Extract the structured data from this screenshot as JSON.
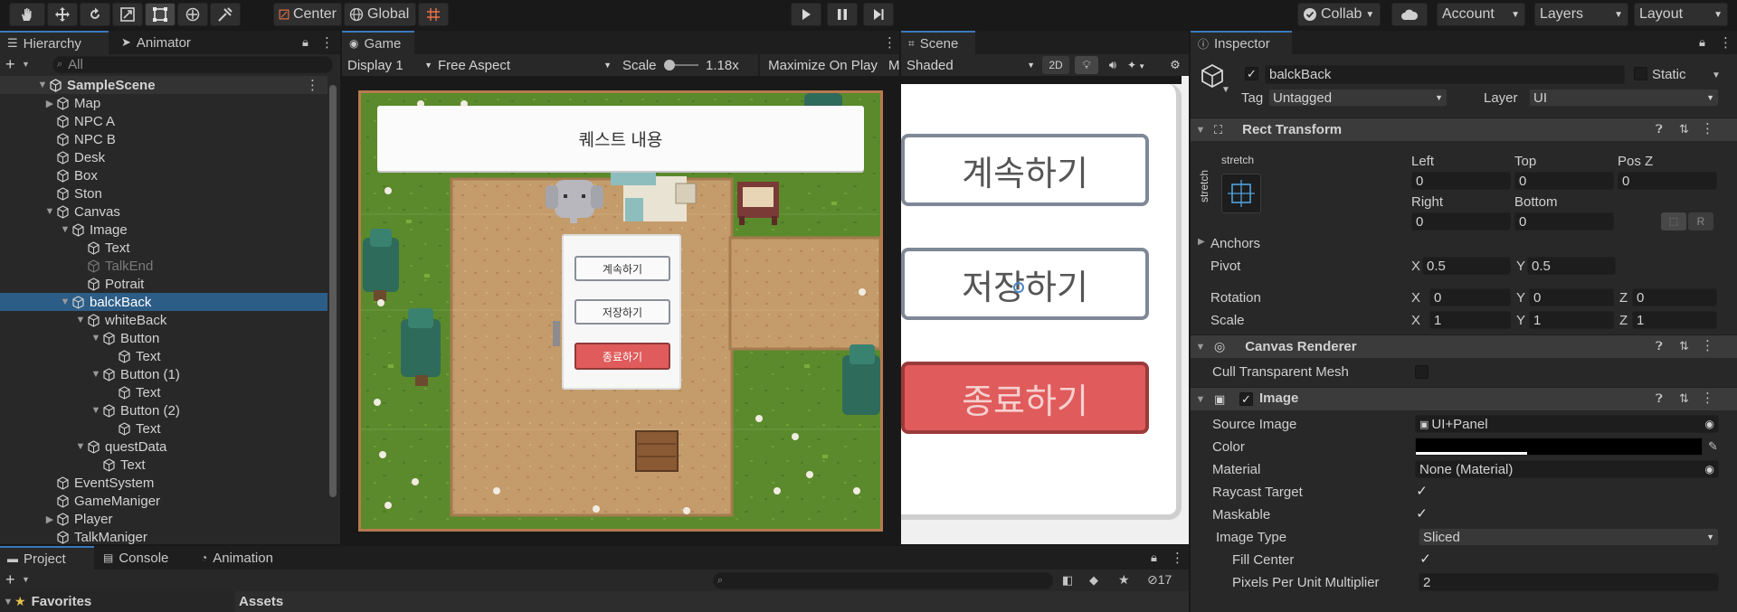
{
  "toolbar": {
    "pivot_label": "Center",
    "space_label": "Global",
    "collab_label": "Collab",
    "account_label": "Account",
    "layers_label": "Layers",
    "layout_label": "Layout"
  },
  "hierarchy": {
    "tab_label": "Hierarchy",
    "animator_tab_label": "Animator",
    "search_placeholder": "All",
    "scene_name": "SampleScene",
    "items": [
      {
        "label": "Map"
      },
      {
        "label": "NPC A"
      },
      {
        "label": "NPC B"
      },
      {
        "label": "Desk"
      },
      {
        "label": "Box"
      },
      {
        "label": "Ston"
      },
      {
        "label": "Canvas"
      },
      {
        "label": "Image"
      },
      {
        "label": "Text"
      },
      {
        "label": "TalkEnd"
      },
      {
        "label": "Potrait"
      },
      {
        "label": "balckBack"
      },
      {
        "label": "whiteBack"
      },
      {
        "label": "Button"
      },
      {
        "label": "Text"
      },
      {
        "label": "Button (1)"
      },
      {
        "label": "Text"
      },
      {
        "label": "Button (2)"
      },
      {
        "label": "Text"
      },
      {
        "label": "questData"
      },
      {
        "label": "Text"
      },
      {
        "label": "EventSystem"
      },
      {
        "label": "GameManiger"
      },
      {
        "label": "Player"
      },
      {
        "label": "TalkManiger"
      }
    ]
  },
  "game": {
    "tab_label": "Game",
    "display": "Display 1",
    "aspect": "Free Aspect",
    "scale_label": "Scale",
    "scale_value": "1.18x",
    "maximize_label": "Maximize On Play",
    "more_label": "M",
    "quest_text": "퀘스트 내용",
    "menu_continue": "계속하기",
    "menu_save": "저장하기",
    "menu_quit": "종료하기"
  },
  "scene": {
    "tab_label": "Scene",
    "shading": "Shaded",
    "mode_2d": "2D",
    "btn_continue": "계속하기",
    "btn_save": "저장하기",
    "btn_quit": "종료하기"
  },
  "inspector": {
    "tab_label": "Inspector",
    "object_name": "balckBack",
    "static_label": "Static",
    "tag_label": "Tag",
    "tag_value": "Untagged",
    "layer_label": "Layer",
    "layer_value": "UI",
    "rect_transform": {
      "title": "Rect Transform",
      "anchor_h": "stretch",
      "anchor_v": "stretch",
      "left_label": "Left",
      "left": "0",
      "top_label": "Top",
      "top": "0",
      "posz_label": "Pos Z",
      "posz": "0",
      "right_label": "Right",
      "right": "0",
      "bottom_label": "Bottom",
      "bottom": "0",
      "r_button": "R",
      "anchors_label": "Anchors",
      "pivot_label": "Pivot",
      "pivot_x": "0.5",
      "pivot_y": "0.5",
      "rotation_label": "Rotation",
      "rot_x": "0",
      "rot_y": "0",
      "rot_z": "0",
      "scale_label": "Scale",
      "scale_x": "1",
      "scale_y": "1",
      "scale_z": "1",
      "x": "X",
      "y": "Y",
      "z": "Z"
    },
    "canvas_renderer": {
      "title": "Canvas Renderer",
      "cull_label": "Cull Transparent Mesh"
    },
    "image": {
      "title": "Image",
      "source_label": "Source Image",
      "source_value": "UI+Panel",
      "color_label": "Color",
      "color_alpha": 0.39,
      "material_label": "Material",
      "material_value": "None (Material)",
      "raycast_label": "Raycast Target",
      "maskable_label": "Maskable",
      "image_type_label": "Image Type",
      "image_type_value": "Sliced",
      "fill_center_label": "Fill Center",
      "ppu_label": "Pixels Per Unit Multiplier",
      "ppu_value": "2"
    }
  },
  "bottom": {
    "project_tab": "Project",
    "console_tab": "Console",
    "animation_tab": "Animation",
    "favorites_label": "Favorites",
    "assets_label": "Assets",
    "hidden_count": "17"
  },
  "colors": {
    "selection": "#2c5d87",
    "accent_tab": "#3a79bb",
    "quit_button": "#e05b5b",
    "grass": "#5f8a2e",
    "dirt": "#c29a6c"
  }
}
